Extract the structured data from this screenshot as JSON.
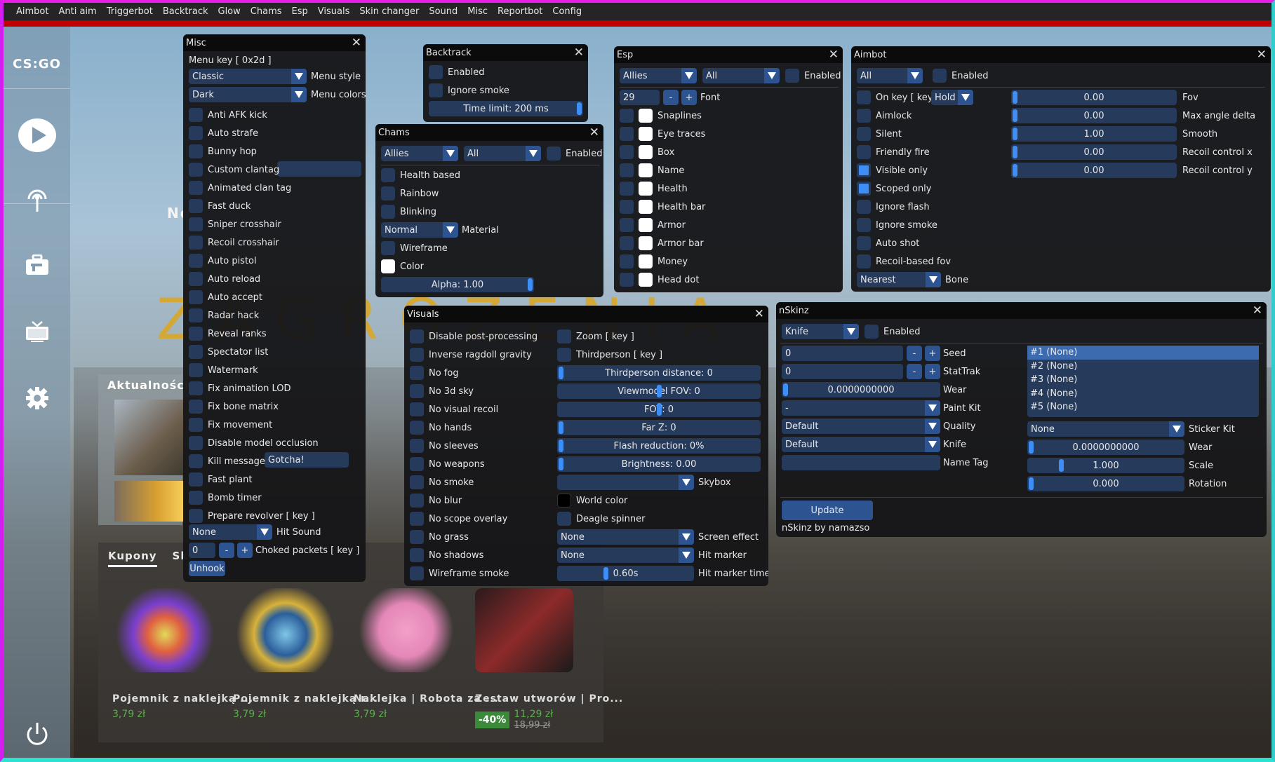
{
  "menubar": {
    "items": [
      "Aimbot",
      "Anti aim",
      "Triggerbot",
      "Backtrack",
      "Glow",
      "Chams",
      "Esp",
      "Visuals",
      "Skin changer",
      "Sound",
      "Misc",
      "Reportbot",
      "Config"
    ]
  },
  "colors": {
    "accent": "#3f8ef5",
    "frame_bg": "#263a5b",
    "button": "#2d5490",
    "titlebar": "#0b0b0c",
    "window": "#161618",
    "menu_red": "#c00000",
    "price_green": "#59b04d"
  },
  "background": {
    "logo": "CS:GO",
    "sidebar_icons": [
      "play-icon",
      "antenna-icon",
      "briefcase-icon",
      "tv-icon",
      "gear-icon",
      "power-icon"
    ],
    "headline_partial": "No",
    "banner_partial": "ZAGROZENIA",
    "news_title": "Aktualności",
    "store": {
      "tabs": [
        "Kupony",
        "Skl"
      ],
      "items": [
        {
          "name": "Pojemnik z naklejką ...",
          "price": "3,79 zł"
        },
        {
          "name": "Pojemnik z naklejką r...",
          "price": "3,79 zł"
        },
        {
          "name": "Naklejka | Robota za ...",
          "price": "3,79 zł"
        },
        {
          "name": "Zestaw utworów | Pro...",
          "price": "11,29 zł",
          "old_price": "18,99 zł",
          "discount": "-40%"
        }
      ]
    }
  },
  "misc": {
    "title": "Misc",
    "menu_key": "Menu key  [ 0x2d ]",
    "menu_style": {
      "value": "Classic",
      "label": "Menu style"
    },
    "menu_colors": {
      "value": "Dark",
      "label": "Menu colors"
    },
    "checkboxes": [
      "Anti AFK kick",
      "Auto strafe",
      "Bunny hop",
      "Custom clantag",
      "Animated clan tag",
      "Fast duck",
      "Sniper crosshair",
      "Recoil crosshair",
      "Auto pistol",
      "Auto reload",
      "Auto accept",
      "Radar hack",
      "Reveal ranks",
      "Spectator list",
      "Watermark",
      "Fix animation LOD",
      "Fix bone matrix",
      "Fix movement",
      "Disable model occlusion",
      "Kill message",
      "Fast plant",
      "Bomb timer",
      "Prepare revolver  [ key ]"
    ],
    "clantag_value": "",
    "kill_message_value": "Gotcha!",
    "hit_sound": {
      "value": "None",
      "label": "Hit Sound"
    },
    "choked_packets": {
      "value": "0",
      "minus": "-",
      "plus": "+",
      "label": "Choked packets  [ key ]"
    },
    "unhook": "Unhook"
  },
  "backtrack": {
    "title": "Backtrack",
    "checkboxes": [
      "Enabled",
      "Ignore smoke"
    ],
    "time_limit": {
      "text": "Time limit: 200 ms",
      "fraction": 1.0
    }
  },
  "chams": {
    "title": "Chams",
    "team": "Allies",
    "target": "All",
    "enabled_label": "Enabled",
    "checkboxes": [
      "Health based",
      "Rainbow",
      "Blinking"
    ],
    "material": {
      "value": "Normal",
      "label": "Material"
    },
    "wireframe": "Wireframe",
    "color_label": "Color",
    "color_value": "#ffffff",
    "alpha": {
      "text": "Alpha: 1.00",
      "fraction": 1.0
    }
  },
  "esp": {
    "title": "Esp",
    "team": "Allies",
    "target": "All",
    "enabled_label": "Enabled",
    "font": {
      "value": "29",
      "minus": "-",
      "plus": "+",
      "label": "Font"
    },
    "items": [
      "Snaplines",
      "Eye traces",
      "Box",
      "Name",
      "Health",
      "Health bar",
      "Armor",
      "Armor bar",
      "Money",
      "Head dot"
    ]
  },
  "aimbot": {
    "title": "Aimbot",
    "weapon": "All",
    "enabled_label": "Enabled",
    "on_key": "On key  [ key ]",
    "mode": "Hold",
    "checkboxes": [
      {
        "label": "Aimlock",
        "checked": false
      },
      {
        "label": "Silent",
        "checked": false
      },
      {
        "label": "Friendly fire",
        "checked": false
      },
      {
        "label": "Visible only",
        "checked": true
      },
      {
        "label": "Scoped only",
        "checked": true
      },
      {
        "label": "Ignore flash",
        "checked": false
      },
      {
        "label": "Ignore smoke",
        "checked": false
      },
      {
        "label": "Auto shot",
        "checked": false
      },
      {
        "label": "Recoil-based fov",
        "checked": false
      }
    ],
    "bone": {
      "value": "Nearest",
      "label": "Bone"
    },
    "sliders": [
      {
        "text": "0.00",
        "label": "Fov",
        "fraction": 0
      },
      {
        "text": "0.00",
        "label": "Max angle delta",
        "fraction": 0
      },
      {
        "text": "1.00",
        "label": "Smooth",
        "fraction": 0
      },
      {
        "text": "0.00",
        "label": "Recoil control x",
        "fraction": 0
      },
      {
        "text": "0.00",
        "label": "Recoil control y",
        "fraction": 0
      }
    ]
  },
  "visuals": {
    "title": "Visuals",
    "left": [
      "Disable post-processing",
      "Inverse ragdoll gravity",
      "No fog",
      "No 3d sky",
      "No visual recoil",
      "No hands",
      "No sleeves",
      "No weapons",
      "No smoke",
      "No blur",
      "No scope overlay",
      "No grass",
      "No shadows",
      "Wireframe smoke"
    ],
    "zoom": "Zoom  [ key ]",
    "thirdperson": "Thirdperson  [ key ]",
    "sliders": [
      {
        "text": "Thirdperson distance: 0",
        "fraction": 0
      },
      {
        "text": "Viewmodel FOV: 0",
        "fraction": 0.5
      },
      {
        "text": "FOV: 0",
        "fraction": 0.5
      },
      {
        "text": "Far Z: 0",
        "fraction": 0
      },
      {
        "text": "Flash reduction: 0%",
        "fraction": 0
      },
      {
        "text": "Brightness: 0.00",
        "fraction": 0
      }
    ],
    "skybox": {
      "value": "",
      "label": "Skybox"
    },
    "world_color": "World color",
    "world_color_value": "#000000",
    "deagle_spinner": "Deagle spinner",
    "screen_effect": {
      "value": "None",
      "label": "Screen effect"
    },
    "hit_marker": {
      "value": "None",
      "label": "Hit marker"
    },
    "hit_marker_time": {
      "text": "0.60s",
      "label": "Hit marker time",
      "fraction": 0.35
    }
  },
  "nskinz": {
    "title": "nSkinz",
    "item": "Knife",
    "enabled_label": "Enabled",
    "seed": {
      "value": "0",
      "label": "Seed"
    },
    "stattrak": {
      "value": "0",
      "label": "StatTrak"
    },
    "minus": "-",
    "plus": "+",
    "wear": {
      "text": "0.0000000000",
      "label": "Wear",
      "fraction": 0
    },
    "paint_kit": {
      "value": "-",
      "label": "Paint Kit"
    },
    "quality": {
      "value": "Default",
      "label": "Quality"
    },
    "knife": {
      "value": "Default",
      "label": "Knife"
    },
    "name_tag": {
      "value": "",
      "label": "Name Tag"
    },
    "sticker_slots": [
      "#1 (None)",
      "#2 (None)",
      "#3 (None)",
      "#4 (None)",
      "#5 (None)"
    ],
    "selected_slot": 0,
    "sticker_kit": {
      "value": "None",
      "label": "Sticker Kit"
    },
    "sticker_wear": {
      "text": "0.0000000000",
      "label": "Wear",
      "fraction": 0
    },
    "sticker_scale": {
      "text": "1.000",
      "label": "Scale",
      "fraction": 0.2
    },
    "sticker_rotation": {
      "text": "0.000",
      "label": "Rotation",
      "fraction": 0
    },
    "update": "Update",
    "footer": "nSkinz by namazso"
  }
}
